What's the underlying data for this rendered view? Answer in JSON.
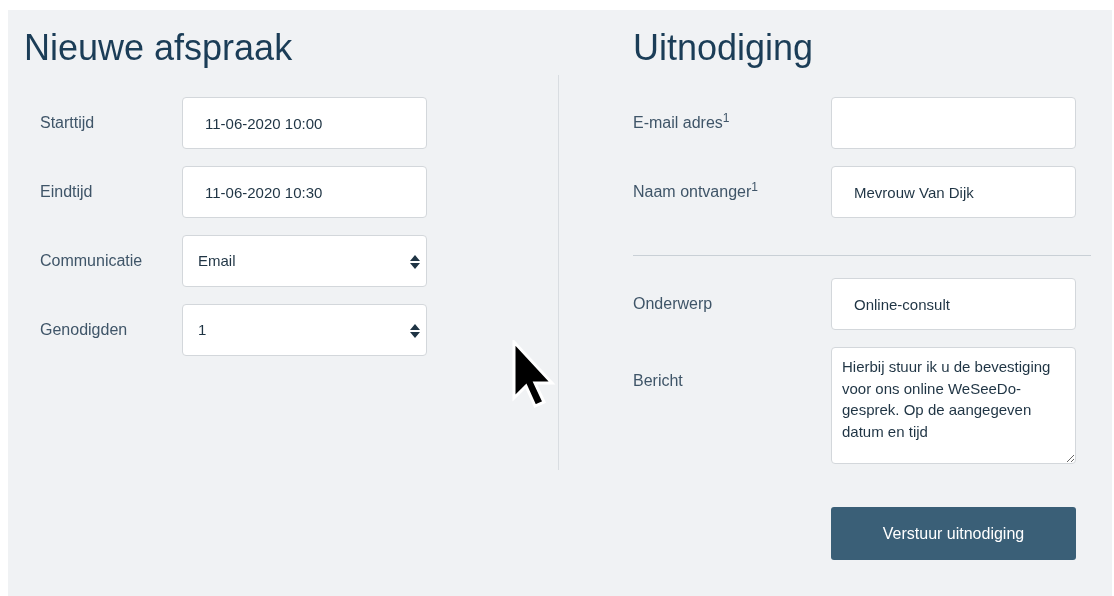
{
  "left": {
    "title": "Nieuwe afspraak",
    "fields": [
      {
        "label": "Starttijd",
        "kind": "text",
        "value": "11-06-2020 10:00"
      },
      {
        "label": "Eindtijd",
        "kind": "text",
        "value": "11-06-2020 10:30"
      },
      {
        "label": "Communicatie",
        "kind": "select",
        "value": "Email"
      },
      {
        "label": "Genodigden",
        "kind": "select",
        "value": "1"
      }
    ]
  },
  "right": {
    "title": "Uitnodiging",
    "recipient_fields": [
      {
        "label": "E-mail adres$^{1}$",
        "kind": "text"
      },
      {
        "label": "Naam ontvanger$^{1}$",
        "kind": "text",
        "value": "Mevrouw Van Dijk"
      }
    ],
    "message_fields": [
      {
        "label": "Onderwerp",
        "kind": "text",
        "value": "Online-consult"
      },
      {
        "label": "Bericht",
        "kind": "textarea",
        "value": "Hierbij stuur ik u de bevestiging voor ons online WeSeeDo-gesprek. Op de aangegeven datum en tijd"
      }
    ],
    "submit_button": "Verstuur uitnodiging"
  }
}
